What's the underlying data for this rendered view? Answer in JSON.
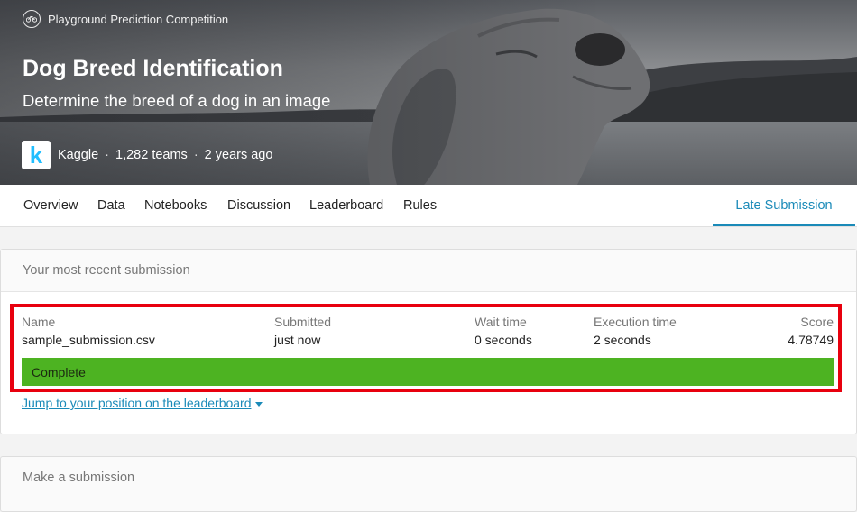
{
  "hero": {
    "competition_type": "Playground Prediction Competition",
    "title": "Dog Breed Identification",
    "subtitle": "Determine the breed of a dog in an image",
    "host": "Kaggle",
    "teams": "1,282 teams",
    "age": "2 years ago",
    "logo_letter": "k",
    "type_icon": "bicycle-icon"
  },
  "nav": {
    "tabs": [
      "Overview",
      "Data",
      "Notebooks",
      "Discussion",
      "Leaderboard",
      "Rules"
    ],
    "late_submission": "Late Submission"
  },
  "recent": {
    "heading": "Your most recent submission",
    "columns": [
      "Name",
      "Submitted",
      "Wait time",
      "Execution time",
      "Score"
    ],
    "row": {
      "name": "sample_submission.csv",
      "submitted": "just now",
      "wait_time": "0 seconds",
      "execution_time": "2 seconds",
      "score": "4.78749"
    },
    "status": "Complete",
    "jump_link": "Jump to your position on the leaderboard"
  },
  "make_submission": {
    "heading": "Make a submission"
  },
  "colors": {
    "accent": "#1a8ab8",
    "complete": "#4db322",
    "highlight": "#e8000e",
    "kaggle": "#20beff"
  }
}
